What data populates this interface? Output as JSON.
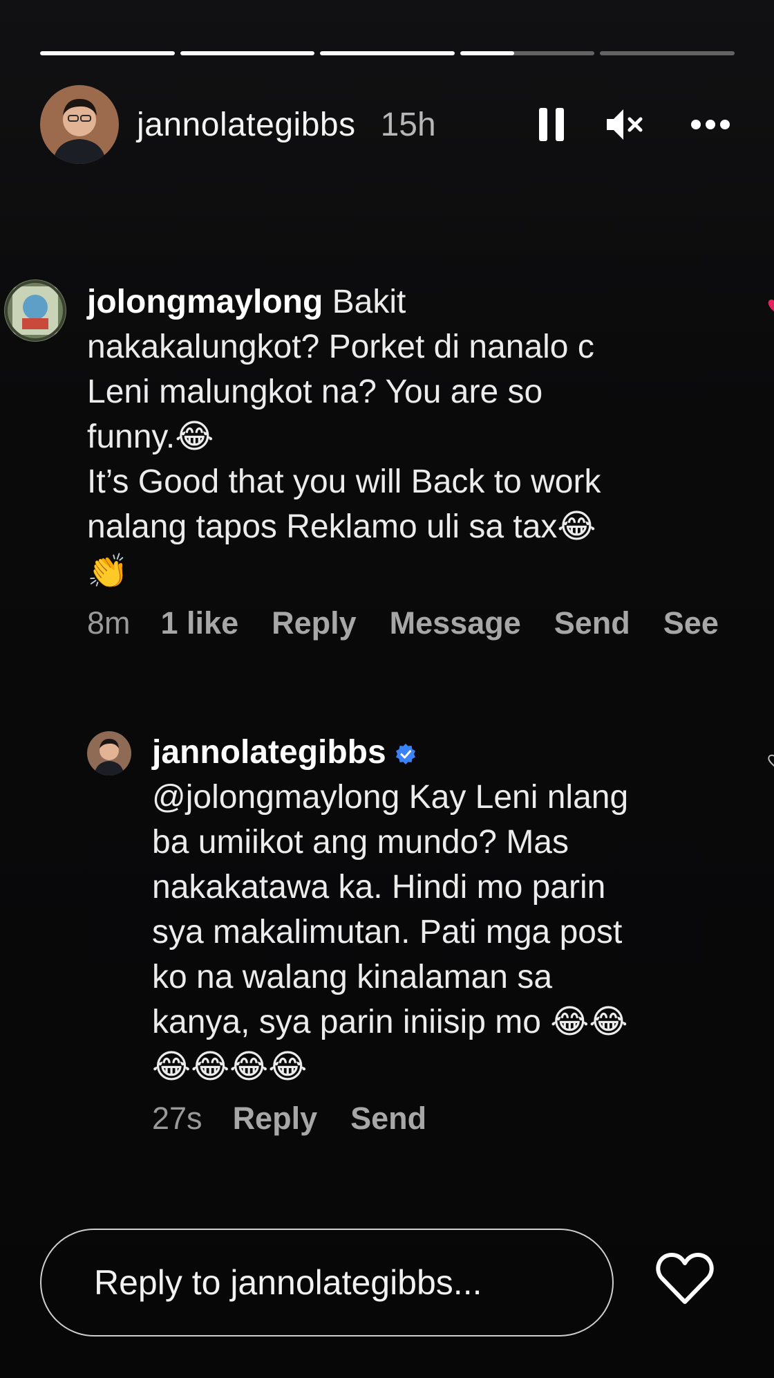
{
  "story": {
    "segments": [
      {
        "progress": 1.0
      },
      {
        "progress": 1.0
      },
      {
        "progress": 1.0
      },
      {
        "progress": 0.4
      },
      {
        "progress": 0.0
      }
    ],
    "username": "jannolategibbs",
    "time_ago": "15h",
    "icons": [
      "pause-icon",
      "mute-icon",
      "more-icon"
    ]
  },
  "comments": [
    {
      "author": "jolongmaylong",
      "text": " Bakit\nnakakalungkot? Porket di nanalo c\nLeni malungkot na? You are so\nfunny.😂\nIt’s Good that you will Back to work\nnalang tapos Reklamo uli sa tax😂\n👏",
      "time": "8m",
      "likes": "1 like",
      "actions": [
        "Reply",
        "Message",
        "Send",
        "See"
      ]
    },
    {
      "author": "jannolategibbs",
      "text": "@jolongmaylong Kay Leni nlang\nba umiikot ang mundo? Mas\nnakakatawa ka. Hindi mo parin\nsya makalimutan. Pati mga post\nko na walang kinalaman sa\nkanya, sya parin iniisip mo 😂😂\n😂😂😂😂",
      "time": "27s",
      "actions": [
        "Reply",
        "Send"
      ]
    }
  ],
  "reply_bar": {
    "placeholder": "Reply to jannolategibbs..."
  },
  "colors": {
    "background": "#0b0b0c",
    "verified": "#3b82f6",
    "like_heart": "#e0245e"
  }
}
